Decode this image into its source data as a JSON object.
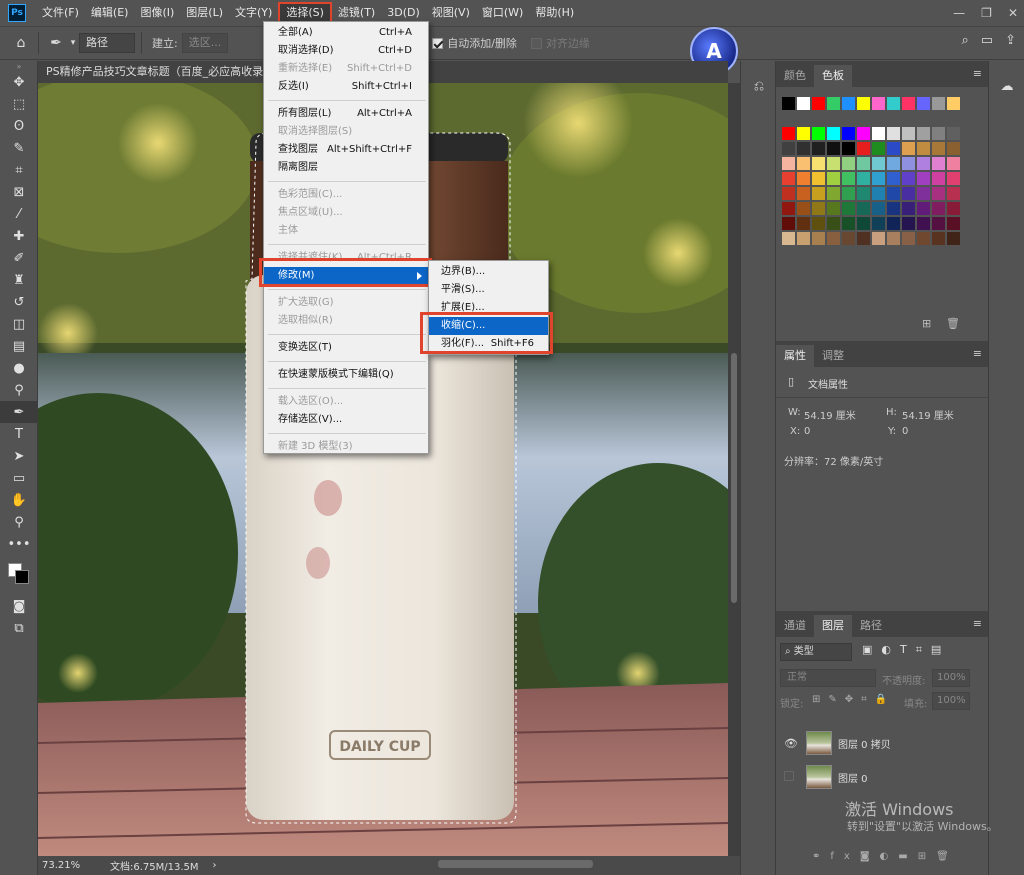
{
  "menubar": {
    "logo": "Ps",
    "items": [
      "文件(F)",
      "编辑(E)",
      "图像(I)",
      "图层(L)",
      "文字(Y)",
      "选择(S)",
      "滤镜(T)",
      "3D(D)",
      "视图(V)",
      "窗口(W)",
      "帮助(H)"
    ],
    "active_index": 5
  },
  "options": {
    "path_mode": "路径",
    "make_label": "建立:",
    "selection_btn": "选区...",
    "auto_add": "自动添加/删除",
    "align_edges": "对齐边缘"
  },
  "document": {
    "tab_title": "PS精修产品技巧文章标题（百度_必应高收录）",
    "zoom": "73.21%",
    "doc_size": "文档:6.75M/13.5M",
    "product_label": "DAILY CUP"
  },
  "select_menu": [
    {
      "label": "全部(A)",
      "shortcut": "Ctrl+A",
      "disabled": false
    },
    {
      "label": "取消选择(D)",
      "shortcut": "Ctrl+D",
      "disabled": false
    },
    {
      "label": "重新选择(E)",
      "shortcut": "Shift+Ctrl+D",
      "disabled": true
    },
    {
      "label": "反选(I)",
      "shortcut": "Shift+Ctrl+I",
      "disabled": false
    },
    {
      "sep": true
    },
    {
      "label": "所有图层(L)",
      "shortcut": "Alt+Ctrl+A",
      "disabled": false
    },
    {
      "label": "取消选择图层(S)",
      "shortcut": "",
      "disabled": true
    },
    {
      "label": "查找图层",
      "shortcut": "Alt+Shift+Ctrl+F",
      "disabled": false
    },
    {
      "label": "隔离图层",
      "shortcut": "",
      "disabled": false
    },
    {
      "sep": true
    },
    {
      "label": "色彩范围(C)...",
      "shortcut": "",
      "disabled": true
    },
    {
      "label": "焦点区域(U)...",
      "shortcut": "",
      "disabled": true
    },
    {
      "label": "主体",
      "shortcut": "",
      "disabled": true
    },
    {
      "sep": true
    },
    {
      "label": "选择并遮住(K)...",
      "shortcut": "Alt+Ctrl+R",
      "disabled": true
    },
    {
      "label": "修改(M)",
      "shortcut": "",
      "disabled": false,
      "highlight": true,
      "submenu": true
    },
    {
      "sep": true
    },
    {
      "label": "扩大选取(G)",
      "shortcut": "",
      "disabled": true
    },
    {
      "label": "选取相似(R)",
      "shortcut": "",
      "disabled": true
    },
    {
      "sep": true
    },
    {
      "label": "变换选区(T)",
      "shortcut": "",
      "disabled": false
    },
    {
      "sep": true
    },
    {
      "label": "在快速蒙版模式下编辑(Q)",
      "shortcut": "",
      "disabled": false
    },
    {
      "sep": true
    },
    {
      "label": "载入选区(O)...",
      "shortcut": "",
      "disabled": true
    },
    {
      "label": "存储选区(V)...",
      "shortcut": "",
      "disabled": false
    },
    {
      "sep": true
    },
    {
      "label": "新建 3D 模型(3)",
      "shortcut": "",
      "disabled": true
    }
  ],
  "modify_submenu": [
    {
      "label": "边界(B)...",
      "shortcut": ""
    },
    {
      "label": "平滑(S)...",
      "shortcut": ""
    },
    {
      "label": "扩展(E)...",
      "shortcut": ""
    },
    {
      "label": "收缩(C)...",
      "shortcut": "",
      "highlight": true
    },
    {
      "label": "羽化(F)...",
      "shortcut": "Shift+F6"
    }
  ],
  "panels": {
    "color_tabs": [
      "颜色",
      "色板"
    ],
    "props_tabs": [
      "属性",
      "调整"
    ],
    "props_title": "文档属性",
    "w_label": "W:",
    "w_value": "54.19 厘米",
    "h_label": "H:",
    "h_value": "54.19 厘米",
    "x_label": "X:",
    "x_value": "0",
    "y_label": "Y:",
    "y_value": "0",
    "resolution": "分辨率：72 像素/英寸",
    "layers_tabs": [
      "通道",
      "图层",
      "路径"
    ],
    "filter_kind": "类型",
    "blend_mode": "正常",
    "opacity_label": "不透明度:",
    "opacity_value": "100%",
    "lock_label": "锁定:",
    "fill_label": "填充:",
    "fill_value": "100%",
    "layers": [
      {
        "name": "图层 0 拷贝",
        "visible": true
      },
      {
        "name": "图层 0",
        "visible": false
      }
    ]
  },
  "watermark": {
    "line1": "激活 Windows",
    "line2": "转到\"设置\"以激活 Windows。"
  },
  "colors": {
    "menu_highlight": "#0c66c8",
    "annotation": "#e0442c"
  }
}
